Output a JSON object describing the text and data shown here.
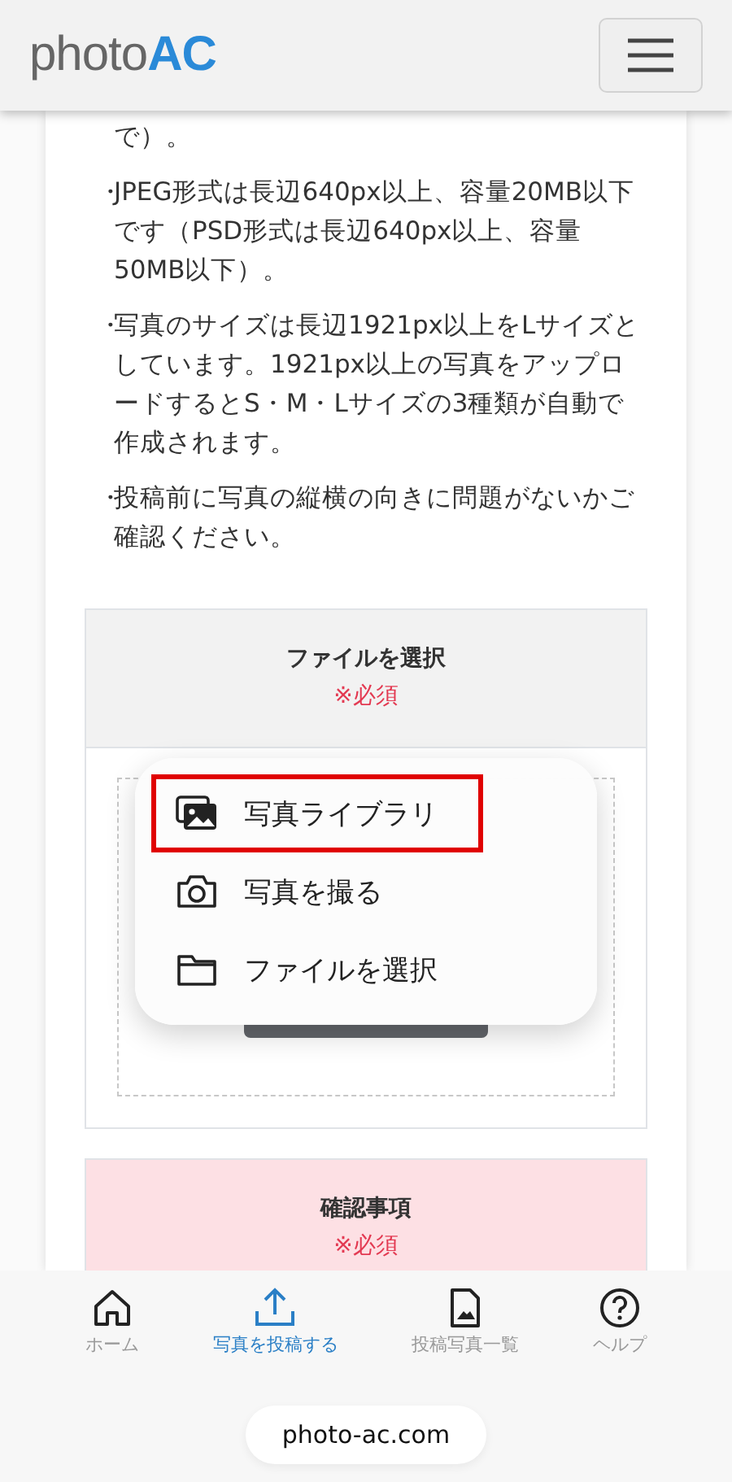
{
  "header": {
    "logo_part1": "photo",
    "logo_part2": "AC"
  },
  "notes": [
    {
      "text": "で）。"
    },
    {
      "mark": "・",
      "text": "JPEG形式は長辺640px以上、容量20MB以下です（PSD形式は長辺640px以上、容量50MB以下）。"
    },
    {
      "mark": "・",
      "text": "写真のサイズは長辺1921px以上をLサイズとしています。1921px以上の写真をアップロードするとS・M・Lサイズの3種類が自動で作成されます。"
    },
    {
      "mark": "・",
      "text": "投稿前に写真の縦横の向きに問題がないかご確認ください。"
    }
  ],
  "file_section": {
    "title": "ファイルを選択",
    "required": "※必須"
  },
  "menu": [
    {
      "kind": "library",
      "label": "写真ライブラリ",
      "selected": true
    },
    {
      "kind": "camera",
      "label": "写真を撮る",
      "selected": false
    },
    {
      "kind": "folder",
      "label": "ファイルを選択",
      "selected": false
    }
  ],
  "confirm_section": {
    "title": "確認事項",
    "required": "※必須"
  },
  "bottom_nav": [
    {
      "kind": "home",
      "label": "ホーム",
      "selected": false
    },
    {
      "kind": "upload",
      "label": "写真を投稿する",
      "selected": true
    },
    {
      "kind": "document",
      "label": "投稿写真一覧",
      "selected": false
    },
    {
      "kind": "help",
      "label": "ヘルプ",
      "selected": false
    }
  ],
  "url": "photo-ac.com"
}
